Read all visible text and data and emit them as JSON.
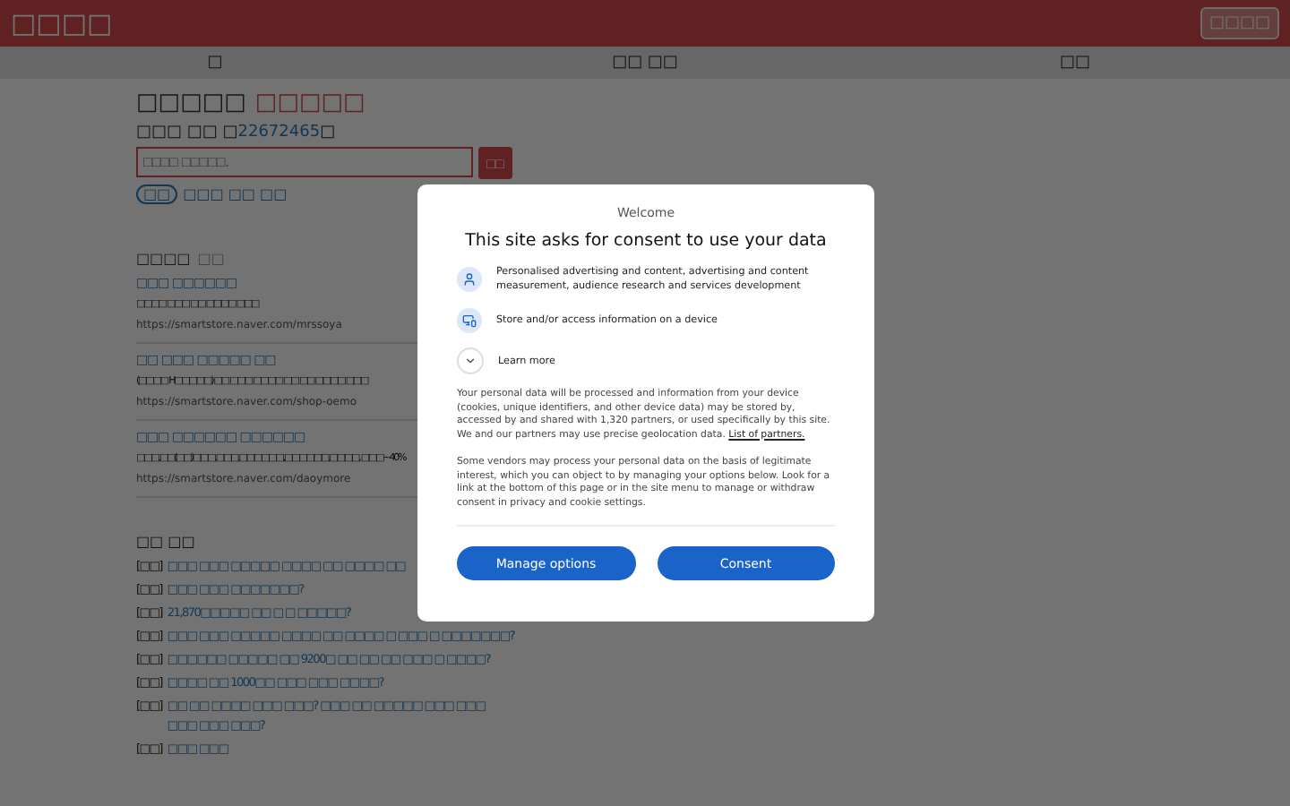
{
  "header": {
    "logo": "□□□□",
    "login": "□□□□"
  },
  "nav": [
    "□",
    "□□ □□",
    "□□"
  ],
  "title": {
    "main": "□□□□□",
    "accent": "□□□□□"
  },
  "count": {
    "prefix": "□□□ □□ □",
    "number": "22672465",
    "suffix": "□"
  },
  "search": {
    "placeholder": "□□□□ □□□□□.",
    "button": "□□"
  },
  "tag": {
    "pill": "□□",
    "link": "□□□ □□ □□"
  },
  "results_heading": {
    "title": "□□□□",
    "sub": "□□"
  },
  "results": [
    {
      "title": "□□□ □□□□□□",
      "desc": "□□□□ □□□ □□ □□□□ □□□",
      "url": "https://smartstore.naver.com/mrssoya"
    },
    {
      "title": "□□ □□□ □□□□□ □□",
      "desc": "(□□□□ H□□□□□) □□ □□□ □□□□ □□ □□ □□□□ □□□",
      "url": "https://smartstore.naver.com/shop-oemo"
    },
    {
      "title": "□□□ □□□□□□ □□□□□□",
      "desc": "□□□,□□(□□)□□□,□□□,□□□□□□,□□□□□□,□□□□, □□□~40%",
      "url": "https://smartstore.naver.com/daoymore"
    }
  ],
  "qa": {
    "heading": "□□ □□",
    "items": [
      {
        "tag": "[□□]",
        "text": "□□□ □□□ □□□□□ □□□□ □□ □□□□ □□"
      },
      {
        "tag": "[□□]",
        "text": "□□□ □□□ □□□□□□□?"
      },
      {
        "tag": "[□□]",
        "text": "21,870□□□□□ □□ □ □ □□□□□?"
      },
      {
        "tag": "[□□]",
        "text": "□□□ □□□ □□□□□ □□□□ □□ □□□□ □ □□□ □ □□□□□□□?"
      },
      {
        "tag": "[□□]",
        "text": "□□□□□□ □□□□□ □□ 9200□ □□ □□ □□ □□□ □ □□□□?"
      },
      {
        "tag": "[□□]",
        "text": "□□□□ □□ 1000□□ □□□ □□□ □□□□?"
      },
      {
        "tag": "[□□]",
        "text": "□□ □□ □□□□ □□□ □□□? □□□ □□ □□□□□ □□□ □□□ □□□ □□□ □□□?"
      },
      {
        "tag": "[□□]",
        "text": "□□□ □□□"
      }
    ]
  },
  "consent": {
    "welcome": "Welcome",
    "title": "This site asks for consent to use your data",
    "purposes": [
      {
        "kind": "person",
        "text": "Personalised advertising and content, advertising and content measurement, audience research and services development"
      },
      {
        "kind": "device",
        "text": "Store and/or access information on a device"
      }
    ],
    "learn_more": "Learn more",
    "paragraph_1": "Your personal data will be processed and information from your device (cookies, unique identifiers, and other device data) may be stored by, accessed by and shared with 1,320 partners, or used specifically by this site. We and our partners may use precise geolocation data.",
    "partners_link": "List of partners.",
    "paragraph_2": "Some vendors may process your personal data on the basis of legitimate interest, which you can object to by managing your options below. Look for a link at the bottom of this page or in the site menu to manage or withdraw consent in privacy and cookie settings.",
    "buttons": [
      "Manage options",
      "Consent"
    ]
  }
}
